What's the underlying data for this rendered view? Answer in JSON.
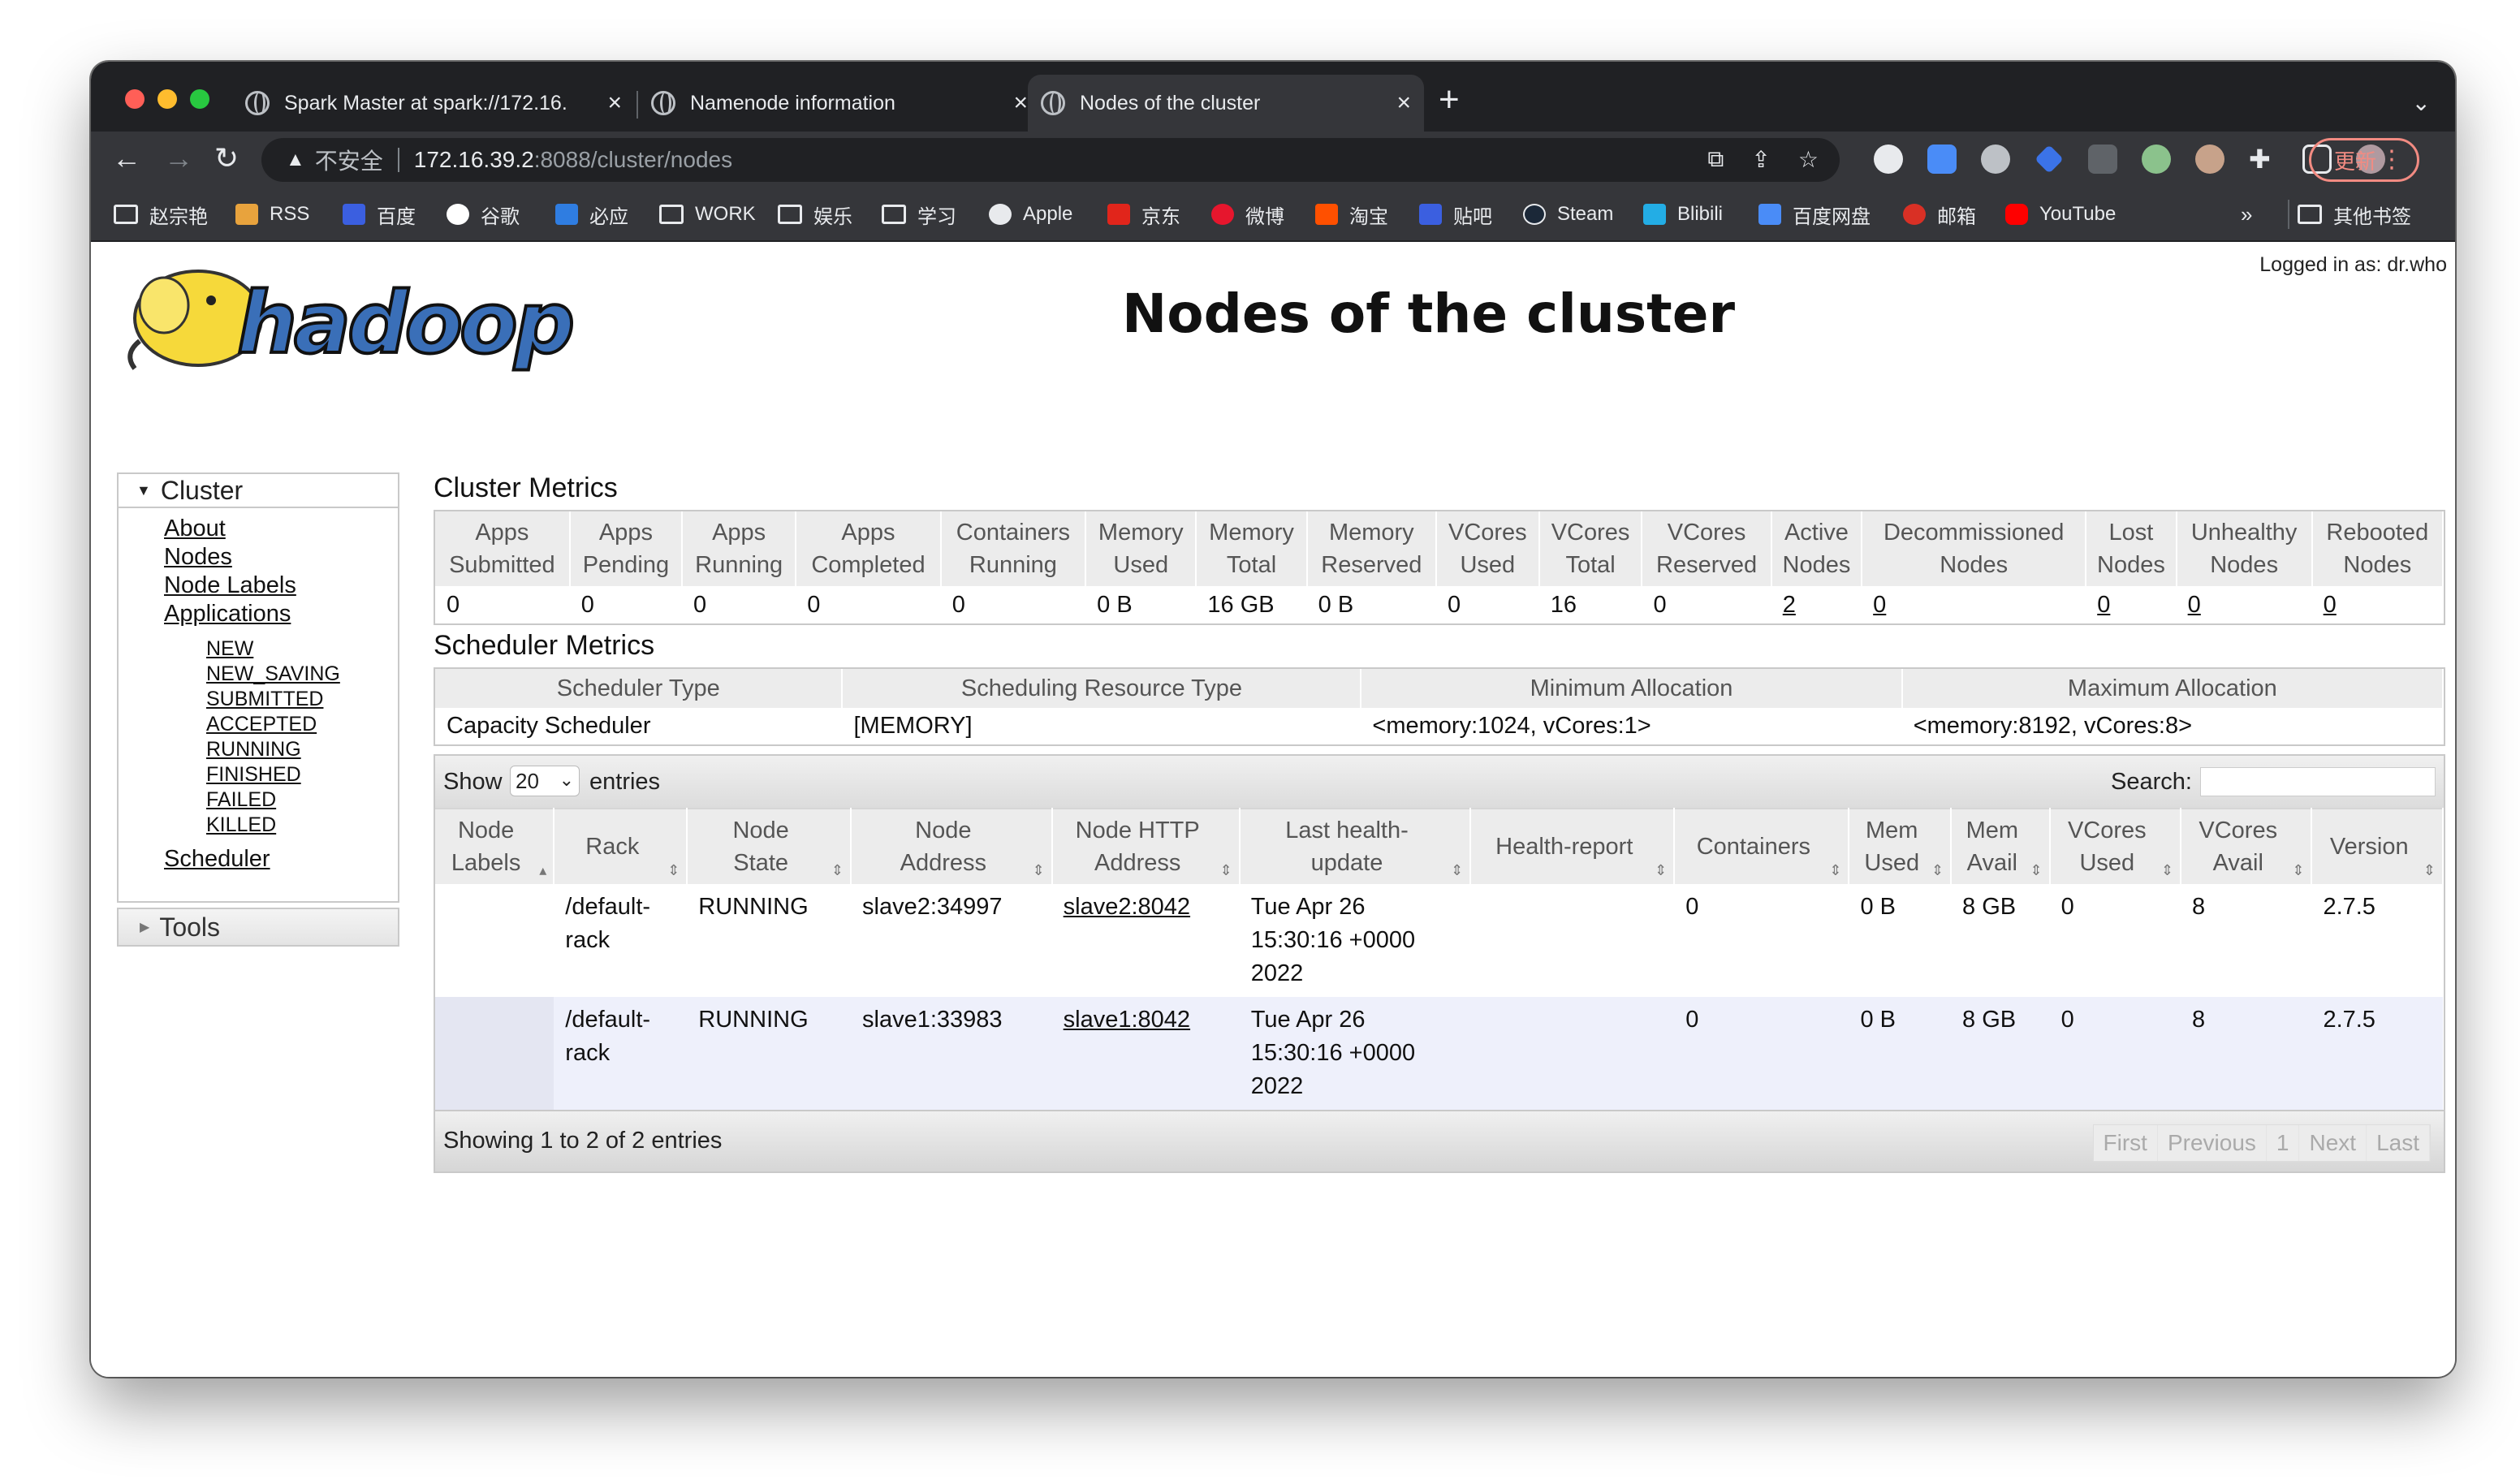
{
  "browser": {
    "tabs": [
      {
        "title": "Spark Master at spark://172.16.",
        "active": false
      },
      {
        "title": "Namenode information",
        "active": false
      },
      {
        "title": "Nodes of the cluster",
        "active": true
      }
    ],
    "address": {
      "security_label": "不安全",
      "host": "172.16.39.2",
      "path": ":8088/cluster/nodes"
    },
    "update_label": "更新",
    "bookmarks": [
      {
        "label": "赵宗艳",
        "icon": "folder-icon"
      },
      {
        "label": "RSS",
        "icon": "rss-icon",
        "color": "#e8a33d"
      },
      {
        "label": "百度",
        "icon": "baidu-icon",
        "color": "#3b5fe0"
      },
      {
        "label": "谷歌",
        "icon": "google-icon",
        "color": "#ffffff"
      },
      {
        "label": "必应",
        "icon": "bing-icon",
        "color": "#2f7de1"
      },
      {
        "label": "WORK",
        "icon": "folder-icon"
      },
      {
        "label": "娱乐",
        "icon": "folder-icon"
      },
      {
        "label": "学习",
        "icon": "folder-icon"
      },
      {
        "label": "Apple",
        "icon": "apple-icon",
        "color": "#e8eaed"
      },
      {
        "label": "京东",
        "icon": "jd-icon",
        "color": "#e1251b"
      },
      {
        "label": "微博",
        "icon": "weibo-icon",
        "color": "#e6162d"
      },
      {
        "label": "淘宝",
        "icon": "taobao-icon",
        "color": "#ff5000"
      },
      {
        "label": "贴吧",
        "icon": "tieba-icon",
        "color": "#3b5fe0"
      },
      {
        "label": "Steam",
        "icon": "steam-icon",
        "color": "#1b2838"
      },
      {
        "label": "Blibili",
        "icon": "bilibili-icon",
        "color": "#23ade5"
      },
      {
        "label": "百度网盘",
        "icon": "baidupan-icon",
        "color": "#4a8cf7"
      },
      {
        "label": "邮箱",
        "icon": "mail-icon",
        "color": "#d93025"
      },
      {
        "label": "YouTube",
        "icon": "youtube-icon",
        "color": "#ff0000"
      }
    ],
    "more_bookmarks": "»",
    "other_bookmarks": "其他书签"
  },
  "page": {
    "logged_in": "Logged in as: dr.who",
    "title": "Nodes of the cluster",
    "logo_text": "hadoop",
    "sidebar": {
      "cluster_label": "Cluster",
      "links": [
        "About",
        "Nodes",
        "Node Labels",
        "Applications"
      ],
      "app_states": [
        "NEW",
        "NEW_SAVING",
        "SUBMITTED",
        "ACCEPTED",
        "RUNNING",
        "FINISHED",
        "FAILED",
        "KILLED"
      ],
      "scheduler": "Scheduler",
      "tools_label": "Tools"
    },
    "cluster_metrics": {
      "title": "Cluster Metrics",
      "headers": [
        [
          "Apps",
          "Submitted"
        ],
        [
          "Apps",
          "Pending"
        ],
        [
          "Apps",
          "Running"
        ],
        [
          "Apps",
          "Completed"
        ],
        [
          "Containers",
          "Running"
        ],
        [
          "Memory",
          "Used"
        ],
        [
          "Memory",
          "Total"
        ],
        [
          "Memory",
          "Reserved"
        ],
        [
          "VCores",
          "Used"
        ],
        [
          "VCores",
          "Total"
        ],
        [
          "VCores",
          "Reserved"
        ],
        [
          "Active",
          "Nodes"
        ],
        [
          "Decommissioned",
          "Nodes"
        ],
        [
          "Lost",
          "Nodes"
        ],
        [
          "Unhealthy",
          "Nodes"
        ],
        [
          "Rebooted",
          "Nodes"
        ]
      ],
      "values": [
        "0",
        "0",
        "0",
        "0",
        "0",
        "0 B",
        "16 GB",
        "0 B",
        "0",
        "16",
        "0",
        "2",
        "0",
        "0",
        "0",
        "0"
      ],
      "linked": [
        false,
        false,
        false,
        false,
        false,
        false,
        false,
        false,
        false,
        false,
        false,
        true,
        true,
        true,
        true,
        true
      ]
    },
    "scheduler_metrics": {
      "title": "Scheduler Metrics",
      "headers": [
        "Scheduler Type",
        "Scheduling Resource Type",
        "Minimum Allocation",
        "Maximum Allocation"
      ],
      "values": [
        "Capacity Scheduler",
        "[MEMORY]",
        "<memory:1024, vCores:1>",
        "<memory:8192, vCores:8>"
      ]
    },
    "nodes_table": {
      "show_label": "Show",
      "page_size": "20",
      "entries_label": "entries",
      "search_label": "Search:",
      "search_value": "",
      "headers": [
        [
          "Node",
          "Labels"
        ],
        [
          "Rack"
        ],
        [
          "Node",
          "State"
        ],
        [
          "Node",
          "Address"
        ],
        [
          "Node HTTP",
          "Address"
        ],
        [
          "Last health-",
          "update"
        ],
        [
          "Health-report"
        ],
        [
          "Containers"
        ],
        [
          "Mem",
          "Used"
        ],
        [
          "Mem",
          "Avail"
        ],
        [
          "VCores",
          "Used"
        ],
        [
          "VCores",
          "Avail"
        ],
        [
          "Version"
        ]
      ],
      "rows": [
        {
          "labels": "",
          "rack": [
            "/default-",
            "rack"
          ],
          "state": "RUNNING",
          "address": "slave2:34997",
          "http": "slave2:8042",
          "health_update": [
            "Tue Apr 26",
            "15:30:16 +0000",
            "2022"
          ],
          "health_report": "",
          "containers": "0",
          "mem_used": "0 B",
          "mem_avail": "8 GB",
          "vcores_used": "0",
          "vcores_avail": "8",
          "version": "2.7.5"
        },
        {
          "labels": "",
          "rack": [
            "/default-",
            "rack"
          ],
          "state": "RUNNING",
          "address": "slave1:33983",
          "http": "slave1:8042",
          "health_update": [
            "Tue Apr 26",
            "15:30:16 +0000",
            "2022"
          ],
          "health_report": "",
          "containers": "0",
          "mem_used": "0 B",
          "mem_avail": "8 GB",
          "vcores_used": "0",
          "vcores_avail": "8",
          "version": "2.7.5"
        }
      ],
      "info": "Showing 1 to 2 of 2 entries",
      "pager": [
        "First",
        "Previous",
        "1",
        "Next",
        "Last"
      ]
    }
  }
}
